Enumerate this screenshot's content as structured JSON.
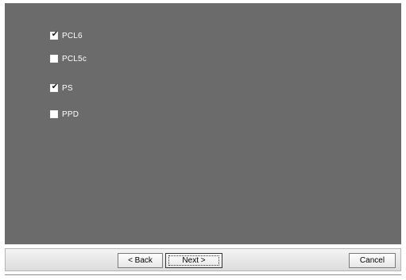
{
  "options": [
    {
      "label": "PCL6",
      "checked": true
    },
    {
      "label": "PCL5c",
      "checked": false
    },
    {
      "label": "PS",
      "checked": true
    },
    {
      "label": "PPD",
      "checked": false
    }
  ],
  "buttons": {
    "back_label": "< Back",
    "next_label": "Next >",
    "cancel_label": "Cancel"
  },
  "colors": {
    "panel_background": "#6b6b6b",
    "label_text": "#ffffff"
  }
}
